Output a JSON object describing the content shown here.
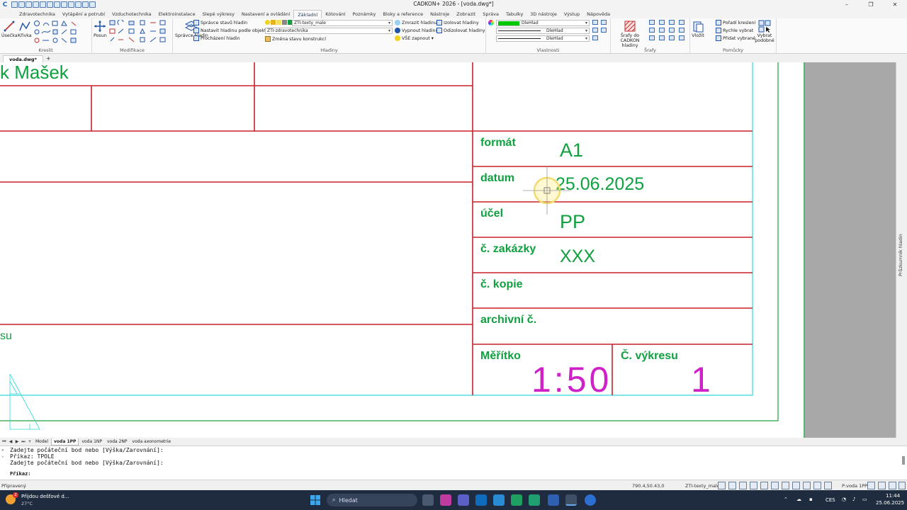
{
  "window": {
    "title": "CADKON+ 2026 - [voda.dwg*]",
    "logo": "C",
    "minimize": "–",
    "maximize": "❐",
    "close": "✕"
  },
  "ribbon_tabs": [
    {
      "label": "Zdravotechnika"
    },
    {
      "label": "Vytápění a potrubí"
    },
    {
      "label": "Vzduchotechnika"
    },
    {
      "label": "Elektroinstalace"
    },
    {
      "label": "Slepé výkresy"
    },
    {
      "label": "Nastavení a ovládání"
    },
    {
      "label": "Základní",
      "active": true
    },
    {
      "label": "Kótování"
    },
    {
      "label": "Poznámky"
    },
    {
      "label": "Bloky a reference"
    },
    {
      "label": "Nástroje"
    },
    {
      "label": "Zobrazit"
    },
    {
      "label": "Správa"
    },
    {
      "label": "Tabulky"
    },
    {
      "label": "3D nástroje"
    },
    {
      "label": "Výstup"
    },
    {
      "label": "Nápověda"
    }
  ],
  "ribbon": {
    "kreslit": {
      "label": "Kreslit",
      "usecka": "Úsečka",
      "krivka": "Křivka"
    },
    "modifikace": {
      "label": "Modifikace",
      "posun": "Posun"
    },
    "hladiny": {
      "label": "Hladiny",
      "spravce_hladin": "Správce hladin",
      "spravce_stavu": "Správce stavů hladin",
      "nastavit_hladinu": "Nastavit hladinu podle objektu",
      "prochazeni": "Procházení hladin",
      "layer_combo": "ZTI-texty_male",
      "layer_combo2": "ZTI-zdravotechnika",
      "zmena_stavu": "Změna stavu konstrukcí",
      "zmrazit": "Zmrazit hladinu",
      "vypnout": "Vypnout hladinu",
      "vse_zapnout": "VŠE zapnout",
      "izolovat": "Izolovat hladiny",
      "odizolovat": "Odizolovat hladiny"
    },
    "vlastnosti": {
      "label": "Vlastnosti",
      "color": "DleHlad",
      "linetype": "DleHlad",
      "lineweight": "DleHlad",
      "color_hex": "#00c800"
    },
    "srafy": {
      "label": "Šrafy",
      "srafy_do": "Šrafy do",
      "cadkon_hladiny": "CADKON hladiny"
    },
    "pomucky": {
      "label": "Pomůcky",
      "vlozit": "Vložit",
      "poradi": "Pořadí kreslení",
      "rychle": "Rychle vybrat",
      "pridat": "Přidat vybrané",
      "vybrat_podobne": "Vybrat podobné"
    }
  },
  "doc_tabs": {
    "active": "voda.dwg*",
    "add": "+"
  },
  "drawing": {
    "name_partial": "k  Mašek",
    "label_partial": "su",
    "cells": {
      "format_label": "formát",
      "format_value": "A1",
      "datum_label": "datum",
      "datum_value": "25.06.2025",
      "ucel_label": "účel",
      "ucel_value": "PP",
      "zakazky_label": "č. zakázky",
      "zakazky_value": "XXX",
      "kopie_label": "č. kopie",
      "archivni_label": "archivní č.",
      "meritko_label": "Měřítko",
      "meritko_value": "1:50",
      "vykresu_label": "Č. výkresu",
      "vykresu_value": "1"
    },
    "colors": {
      "frame_red": "#c8202a",
      "text_green": "#10a040",
      "text_magenta": "#d020c8",
      "border_cyan": "#30d8d8",
      "border_green": "#20a040",
      "outer_gray": "#a8a8a8"
    }
  },
  "side_panel": {
    "label": "Průzkumník hladin"
  },
  "layout_tabs": [
    {
      "label": "Model"
    },
    {
      "label": "voda 1PP",
      "active": true
    },
    {
      "label": "voda 1NP"
    },
    {
      "label": "voda 2NP"
    },
    {
      "label": "voda axonometrie"
    }
  ],
  "command": {
    "lines": [
      "Zadejte počáteční bod nebo [Výška/Zarovnání]:",
      "Příkaz: TPOLE",
      "Zadejte počáteční bod nebo [Výška/Zarovnání]:"
    ],
    "prompt": "Příkaz:",
    "input": ""
  },
  "status": {
    "ready": "Připravený",
    "coords": "790.4,50.43,0",
    "layer": "ZTI-texty_male",
    "layout": "P:voda 1PP"
  },
  "taskbar": {
    "weather_title": "Přijdou dešťové d...",
    "weather_temp": "27°C",
    "weather_badge": "2",
    "search": "Hledat",
    "lang": "CES",
    "time": "11:44",
    "date": "25.06.2025"
  }
}
